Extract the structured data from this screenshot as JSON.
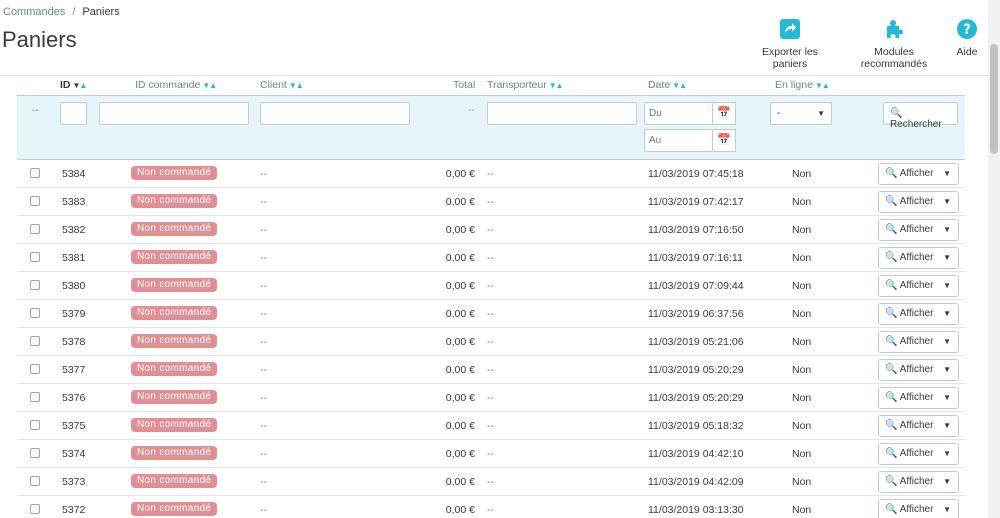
{
  "breadcrumb": {
    "parent": "Commandes",
    "separator": "/",
    "current": "Paniers"
  },
  "page": {
    "title": "Paniers"
  },
  "toolbar": {
    "export_label": "Exporter les paniers",
    "modules_label": "Modules recommandés",
    "help_label": "Aide"
  },
  "colors": {
    "accent": "#25b9d7",
    "badge": "#e08f95",
    "filter_bg": "#e7f5fb"
  },
  "icons": {
    "export": "share-square-icon",
    "modules": "puzzle-icon",
    "help": "question-circle-icon",
    "calendar": "calendar-icon",
    "search": "search-icon"
  },
  "columns": {
    "id": "ID",
    "order_id": "ID commande",
    "client": "Client",
    "total": "Total",
    "carrier": "Transporteur",
    "date": "Date",
    "online": "En ligne"
  },
  "filters": {
    "checkbox_dash": "--",
    "total_dash": "--",
    "date_from_placeholder": "Du",
    "date_to_placeholder": "Au",
    "online_value": "-",
    "search_label": "Rechercher"
  },
  "rows": [
    {
      "id": "5384",
      "status": "Non commandé",
      "client": "--",
      "total": "0,00 €",
      "carrier": "--",
      "date": "11/03/2019 07:45:18",
      "online": "Non",
      "action": "Afficher"
    },
    {
      "id": "5383",
      "status": "Non commandé",
      "client": "--",
      "total": "0,00 €",
      "carrier": "--",
      "date": "11/03/2019 07:42:17",
      "online": "Non",
      "action": "Afficher"
    },
    {
      "id": "5382",
      "status": "Non commandé",
      "client": "--",
      "total": "0,00 €",
      "carrier": "--",
      "date": "11/03/2019 07:16:50",
      "online": "Non",
      "action": "Afficher"
    },
    {
      "id": "5381",
      "status": "Non commandé",
      "client": "--",
      "total": "0,00 €",
      "carrier": "--",
      "date": "11/03/2019 07:16:11",
      "online": "Non",
      "action": "Afficher"
    },
    {
      "id": "5380",
      "status": "Non commandé",
      "client": "--",
      "total": "0,00 €",
      "carrier": "--",
      "date": "11/03/2019 07:09:44",
      "online": "Non",
      "action": "Afficher"
    },
    {
      "id": "5379",
      "status": "Non commandé",
      "client": "--",
      "total": "0,00 €",
      "carrier": "--",
      "date": "11/03/2019 06:37:56",
      "online": "Non",
      "action": "Afficher"
    },
    {
      "id": "5378",
      "status": "Non commandé",
      "client": "--",
      "total": "0,00 €",
      "carrier": "--",
      "date": "11/03/2019 05:21:06",
      "online": "Non",
      "action": "Afficher"
    },
    {
      "id": "5377",
      "status": "Non commandé",
      "client": "--",
      "total": "0,00 €",
      "carrier": "--",
      "date": "11/03/2019 05:20:29",
      "online": "Non",
      "action": "Afficher"
    },
    {
      "id": "5376",
      "status": "Non commandé",
      "client": "--",
      "total": "0,00 €",
      "carrier": "--",
      "date": "11/03/2019 05:20:29",
      "online": "Non",
      "action": "Afficher"
    },
    {
      "id": "5375",
      "status": "Non commandé",
      "client": "--",
      "total": "0,00 €",
      "carrier": "--",
      "date": "11/03/2019 05:18:32",
      "online": "Non",
      "action": "Afficher"
    },
    {
      "id": "5374",
      "status": "Non commandé",
      "client": "--",
      "total": "0,00 €",
      "carrier": "--",
      "date": "11/03/2019 04:42:10",
      "online": "Non",
      "action": "Afficher"
    },
    {
      "id": "5373",
      "status": "Non commandé",
      "client": "--",
      "total": "0,00 €",
      "carrier": "--",
      "date": "11/03/2019 04:42:09",
      "online": "Non",
      "action": "Afficher"
    },
    {
      "id": "5372",
      "status": "Non commandé",
      "client": "--",
      "total": "0,00 €",
      "carrier": "--",
      "date": "11/03/2019 03:13:30",
      "online": "Non",
      "action": "Afficher"
    }
  ]
}
